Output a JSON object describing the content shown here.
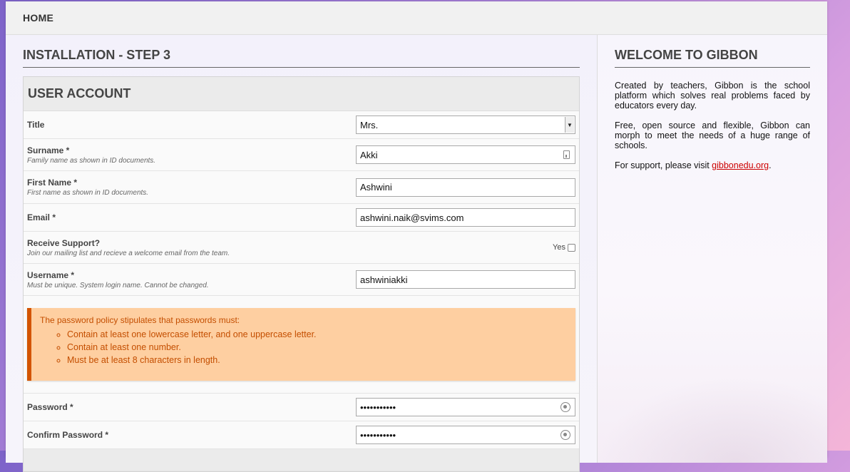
{
  "nav": {
    "home": "HOME"
  },
  "main": {
    "title": "INSTALLATION - STEP 3",
    "section": "USER ACCOUNT",
    "fields": {
      "title": {
        "label": "Title",
        "value": "Mrs."
      },
      "surname": {
        "label": "Surname *",
        "desc": "Family name as shown in ID documents.",
        "value": "Akki"
      },
      "firstname": {
        "label": "First Name *",
        "desc": "First name as shown in ID documents.",
        "value": "Ashwini"
      },
      "email": {
        "label": "Email *",
        "value": "ashwini.naik@svims.com"
      },
      "support": {
        "label": "Receive Support?",
        "desc": "Join our mailing list and recieve a welcome email from the team.",
        "option": "Yes"
      },
      "username": {
        "label": "Username *",
        "desc": "Must be unique. System login name. Cannot be changed.",
        "value": "ashwiniakki"
      },
      "password": {
        "label": "Password *",
        "value": "•••••••••••"
      },
      "confirm": {
        "label": "Confirm Password *",
        "value": "•••••••••••"
      }
    },
    "policy": {
      "intro": "The password policy stipulates that passwords must:",
      "items": [
        "Contain at least one lowercase letter, and one uppercase letter.",
        "Contain at least one number.",
        "Must be at least 8 characters in length."
      ]
    }
  },
  "sidebar": {
    "title": "WELCOME TO GIBBON",
    "p1": "Created by teachers, Gibbon is the school platform which solves real problems faced by educators every day.",
    "p2": "Free, open source and flexible, Gibbon can morph to meet the needs of a huge range of schools.",
    "p3_prefix": "For support, please visit ",
    "p3_link": "gibbonedu.org",
    "p3_suffix": "."
  },
  "colors": {
    "policy_bg": "#fecfa1",
    "policy_text": "#c44e00",
    "link": "#cc0000"
  }
}
